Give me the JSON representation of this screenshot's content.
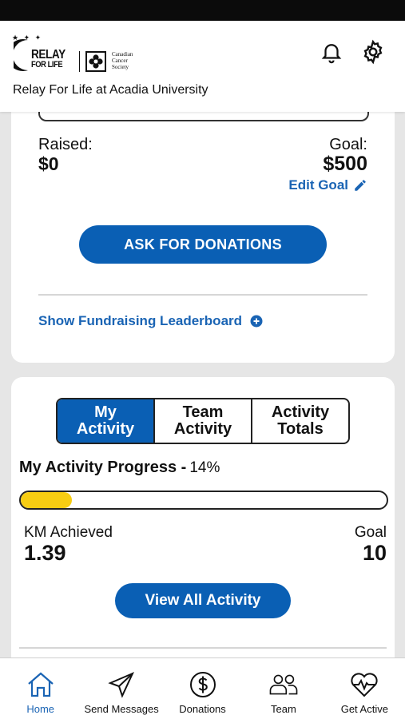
{
  "header": {
    "logo_line1": "RELAY",
    "logo_line2": "FOR LIFE",
    "logo_ccs": [
      "Canadian",
      "Cancer",
      "Society"
    ],
    "title": "Relay For Life at Acadia University",
    "icons": [
      "bell-icon",
      "gear-icon"
    ]
  },
  "fundraising": {
    "raised_label": "Raised:",
    "raised_value": "$0",
    "goal_label": "Goal:",
    "goal_value": "$500",
    "edit_goal": "Edit Goal",
    "ask_button": "ASK FOR DONATIONS",
    "leaderboard_link": "Show Fundraising Leaderboard"
  },
  "activity": {
    "tabs": [
      {
        "label": "My\nActivity",
        "active": true
      },
      {
        "label": "Team\nActivity",
        "active": false
      },
      {
        "label": "Activity\nTotals",
        "active": false
      }
    ],
    "progress_title": "My Activity Progress -",
    "progress_pct_label": "14%",
    "progress_fraction": 0.14,
    "km_label": "KM Achieved",
    "km_value": "1.39",
    "goal_label": "Goal",
    "goal_value": "10",
    "view_button": "View All Activity"
  },
  "tabbar": {
    "items": [
      {
        "label": "Home",
        "icon": "home-icon",
        "active": true
      },
      {
        "label": "Send Messages",
        "icon": "paper-plane-icon",
        "active": false
      },
      {
        "label": "Donations",
        "icon": "dollar-icon",
        "active": false
      },
      {
        "label": "Team",
        "icon": "team-icon",
        "active": false
      },
      {
        "label": "Get Active",
        "icon": "heart-pulse-icon",
        "active": false
      }
    ]
  },
  "colors": {
    "primary": "#0a5fb4",
    "link": "#1a64b4",
    "progress": "#f7cd12"
  }
}
